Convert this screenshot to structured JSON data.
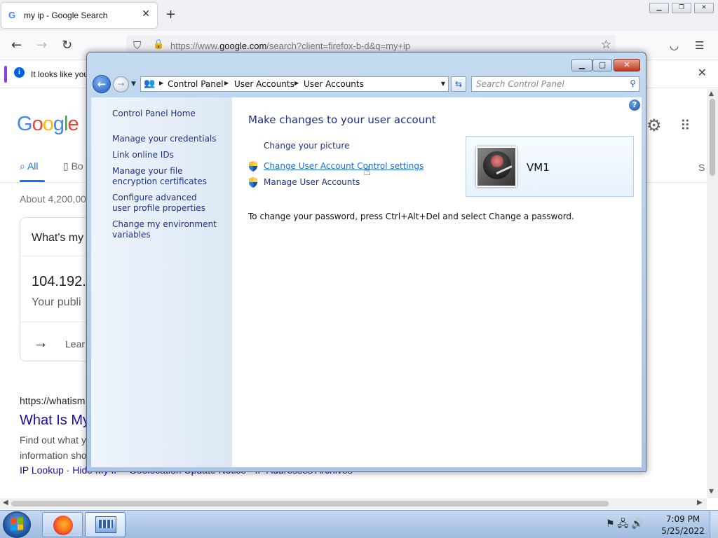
{
  "browser": {
    "tab_title": "my ip - Google Search",
    "tab_favicon": "G",
    "url_host_prefix": "https://www.",
    "url_host": "google.com",
    "url_path": "/search?client=firefox-b-d&q=my+ip",
    "notice_text": "It looks like you",
    "icons": {
      "back": "←",
      "forward": "→",
      "reload": "↻",
      "shield": "⛉",
      "lock": "🔒",
      "star": "☆",
      "pocket": "⛉",
      "menu": "☰",
      "close": "✕",
      "new_tab": "+",
      "info": "i"
    }
  },
  "google": {
    "logo": [
      "G",
      "o",
      "o",
      "g",
      "l",
      "e"
    ],
    "logo_colors": [
      "#4285f4",
      "#ea4335",
      "#fbbc05",
      "#4285f4",
      "#34a853",
      "#ea4335"
    ],
    "tab_all": "All",
    "tab_books": "Bo",
    "tab_s": "S",
    "about": "About 4,200,00",
    "card_question": "What's my",
    "card_ip": "104.192.",
    "card_public": "Your publi",
    "card_learn": "Lear",
    "result_cite": "https://whatism",
    "result_title": "What Is My",
    "snippet_line1": "Find out what y",
    "snippet_line2": "information sho",
    "sitelinks": "IP Lookup · Hide My IP · Geolocation Update Notice · IP Addresses Archives"
  },
  "control_panel": {
    "breadcrumbs": [
      "Control Panel",
      "User Accounts",
      "User Accounts"
    ],
    "search_placeholder": "Search Control Panel",
    "left_links": [
      "Control Panel Home",
      "Manage your credentials",
      "Link online IDs",
      "Manage your file encryption certificates",
      "Configure advanced user profile properties",
      "Change my environment variables"
    ],
    "title": "Make changes to your user account",
    "tasks": [
      {
        "label": "Change your picture",
        "uac_shield": false
      },
      {
        "label": "Change User Account Control settings",
        "uac_shield": true
      },
      {
        "label": "Manage User Accounts",
        "uac_shield": true
      }
    ],
    "password_note": "To change your password, press Ctrl+Alt+Del and select Change a password.",
    "user_name": "VM1",
    "help_glyph": "?"
  },
  "taskbar": {
    "time": "7:09 PM",
    "date": "5/25/2022"
  }
}
